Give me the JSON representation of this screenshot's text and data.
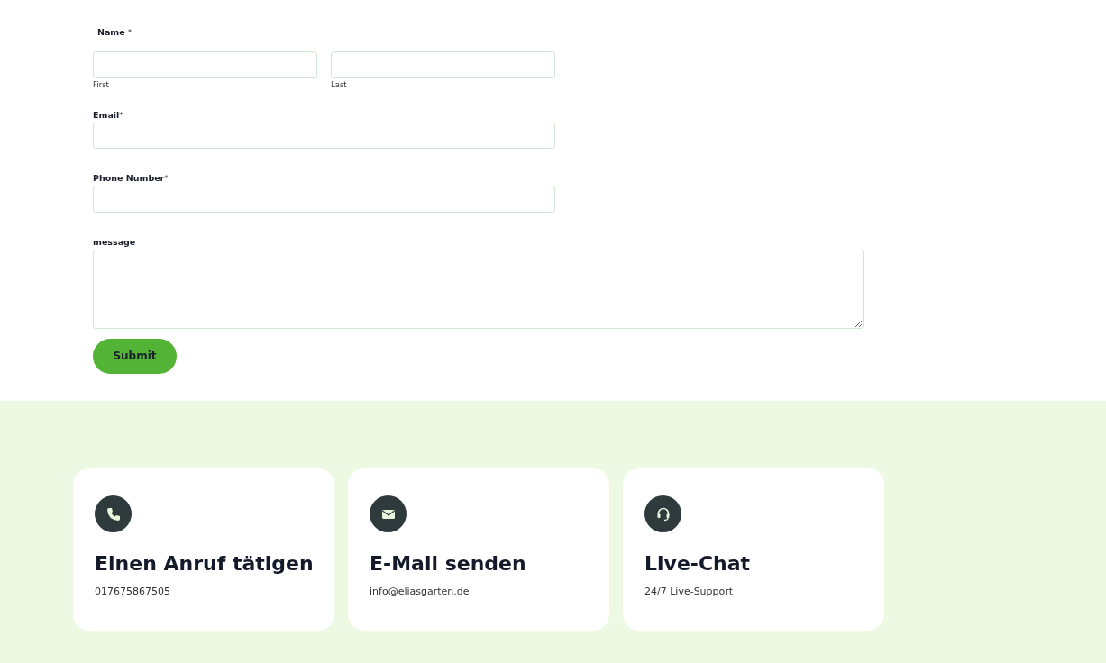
{
  "form": {
    "name": {
      "label": "Name",
      "required_mark": "*",
      "parts": [
        {
          "sublabel": "First"
        },
        {
          "sublabel": "Last"
        }
      ]
    },
    "fields": [
      {
        "label": "Email",
        "required_mark": "*",
        "kind": "input"
      },
      {
        "label": "Phone Number",
        "required_mark": "*",
        "kind": "input"
      },
      {
        "label": "message",
        "kind": "textarea"
      }
    ],
    "submit": "Submit"
  },
  "contact_cards": [
    {
      "kind": "phone",
      "title": "Einen Anruf tätigen",
      "text": "017675867505"
    },
    {
      "kind": "email",
      "title": "E-Mail senden",
      "text": "info@eliasgarten.de"
    },
    {
      "kind": "chat",
      "title": "Live-Chat",
      "text": "24/7 Live-Support"
    }
  ]
}
